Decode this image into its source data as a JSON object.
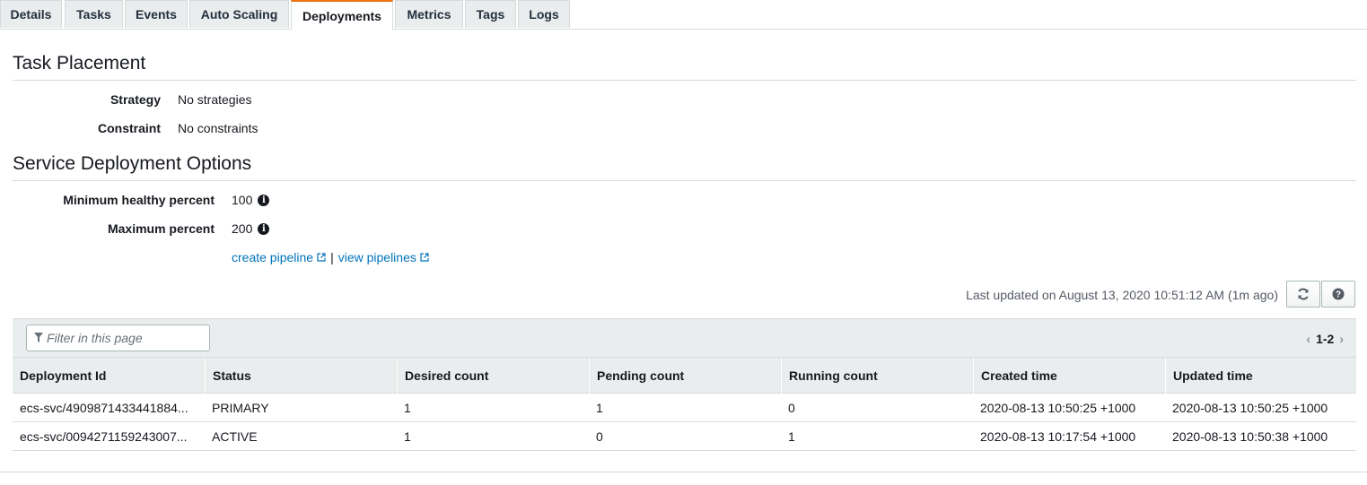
{
  "tabs": [
    {
      "label": "Details",
      "active": false
    },
    {
      "label": "Tasks",
      "active": false
    },
    {
      "label": "Events",
      "active": false
    },
    {
      "label": "Auto Scaling",
      "active": false
    },
    {
      "label": "Deployments",
      "active": true
    },
    {
      "label": "Metrics",
      "active": false
    },
    {
      "label": "Tags",
      "active": false
    },
    {
      "label": "Logs",
      "active": false
    }
  ],
  "task_placement": {
    "title": "Task Placement",
    "strategy_label": "Strategy",
    "strategy_value": "No strategies",
    "constraint_label": "Constraint",
    "constraint_value": "No constraints"
  },
  "deployment_options": {
    "title": "Service Deployment Options",
    "min_healthy_label": "Minimum healthy percent",
    "min_healthy_value": "100",
    "max_percent_label": "Maximum percent",
    "max_percent_value": "200",
    "create_pipeline_link": "create pipeline",
    "separator": "|",
    "view_pipelines_link": "view pipelines"
  },
  "toolbar": {
    "last_updated": "Last updated on August 13, 2020 10:51:12 AM (1m ago)",
    "refresh_icon": "refresh-icon",
    "help_icon": "help-icon"
  },
  "table": {
    "filter_placeholder": "Filter in this page",
    "pagination": "1-2",
    "columns": [
      "Deployment Id",
      "Status",
      "Desired count",
      "Pending count",
      "Running count",
      "Created time",
      "Updated time"
    ],
    "rows": [
      [
        "ecs-svc/4909871433441884...",
        "PRIMARY",
        "1",
        "1",
        "0",
        "2020-08-13 10:50:25 +1000",
        "2020-08-13 10:50:25 +1000"
      ],
      [
        "ecs-svc/0094271159243007...",
        "ACTIVE",
        "1",
        "0",
        "1",
        "2020-08-13 10:17:54 +1000",
        "2020-08-13 10:50:38 +1000"
      ]
    ]
  },
  "colors": {
    "accent": "#ec7211",
    "link": "#0073bb",
    "header_bg": "#eaeded"
  }
}
